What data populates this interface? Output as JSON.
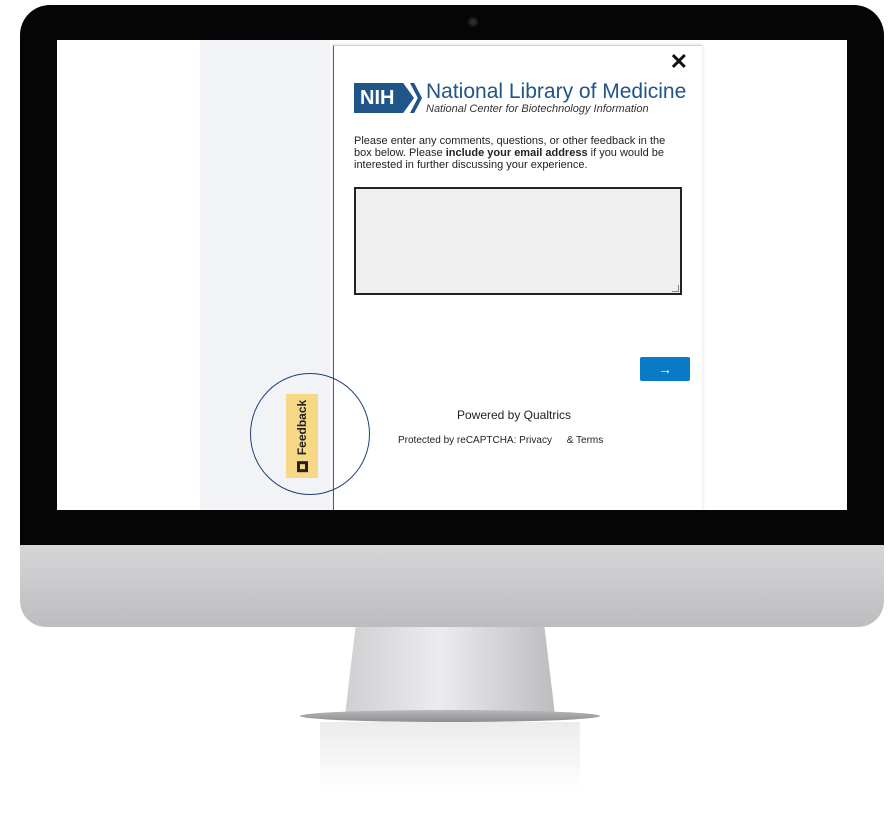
{
  "modal": {
    "close_glyph": "✕",
    "logo": {
      "badge": "NIH",
      "title": "National Library of Medicine",
      "subtitle": "National Center for Biotechnology Information"
    },
    "intro": {
      "part1": "Please enter any comments, questions, or other feedback in the box below. Please ",
      "bold": "include your email address",
      "part2": " if you would be interested in further discussing your experience."
    },
    "textarea_value": "",
    "next_button": "→",
    "powered_by": "Powered by Qualtrics",
    "recaptcha": {
      "prefix": "Protected by reCAPTCHA:",
      "privacy": "Privacy",
      "terms": "& Terms"
    }
  },
  "feedback_tab": {
    "label": "Feedback"
  },
  "colors": {
    "nih_blue": "#20558a",
    "button_blue": "#0b7ac6",
    "feedback_tab_yellow": "#f6d886",
    "highlight_circle": "#1f3f77"
  }
}
